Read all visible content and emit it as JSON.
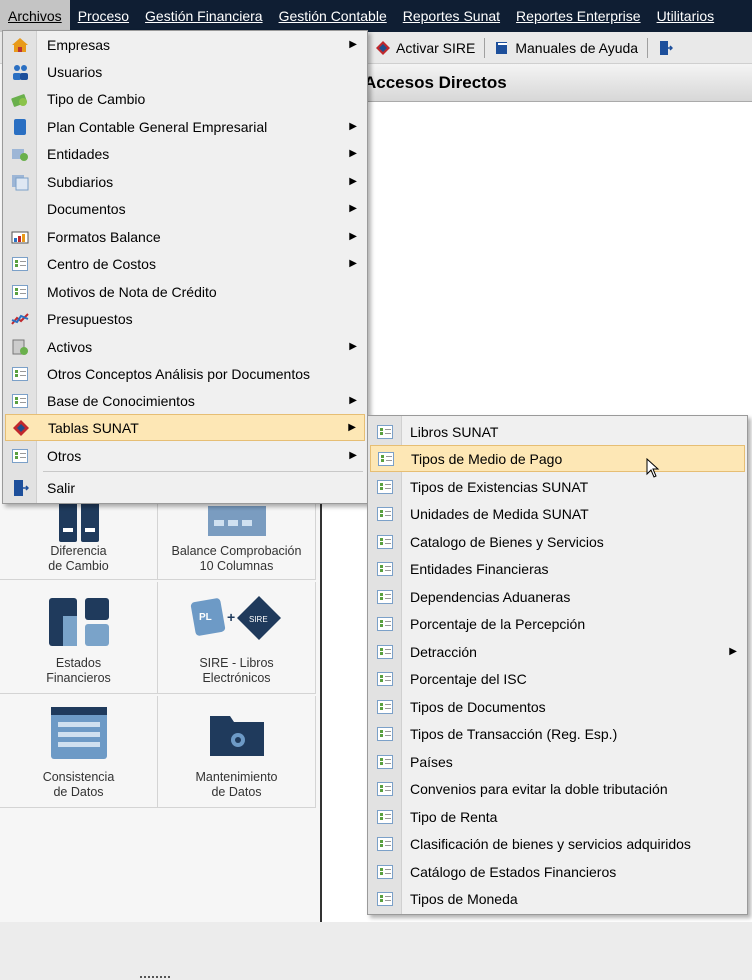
{
  "menubar": [
    {
      "label": "Archivos",
      "active": true
    },
    {
      "label": "Proceso"
    },
    {
      "label": "Gestión Financiera"
    },
    {
      "label": "Gestión Contable"
    },
    {
      "label": "Reportes Sunat"
    },
    {
      "label": "Reportes Enterprise"
    },
    {
      "label": "Utilitarios"
    }
  ],
  "toolbar": {
    "activar_sire": "Activar SIRE",
    "manuales": "Manuales de Ayuda"
  },
  "accesos": {
    "title": "Accesos Directos",
    "tiles": [
      {
        "line1": "Diferencia",
        "line2": "de Cambio",
        "icon": "calculator-icon"
      },
      {
        "line1": "Balance Comprobación",
        "line2": "10 Columnas",
        "icon": "grid-icon"
      },
      {
        "line1": "Estados",
        "line2": "Financieros",
        "icon": "columns-icon"
      },
      {
        "line1": "SIRE - Libros",
        "line2": "Electrónicos",
        "icon": "ple-sire-icon"
      },
      {
        "line1": "Consistencia",
        "line2": "de Datos",
        "icon": "window-icon"
      },
      {
        "line1": "Mantenimiento",
        "line2": "de Datos",
        "icon": "folder-gear-icon"
      }
    ]
  },
  "archivos_menu": [
    {
      "label": "Empresas",
      "sub": true,
      "icon": "home-icon"
    },
    {
      "label": "Usuarios",
      "sub": false,
      "icon": "users-icon"
    },
    {
      "label": "Tipo de Cambio",
      "sub": false,
      "icon": "money-icon"
    },
    {
      "label": "Plan Contable General Empresarial",
      "sub": true,
      "icon": "book-icon"
    },
    {
      "label": "Entidades",
      "sub": true,
      "icon": "entity-icon"
    },
    {
      "label": "Subdiarios",
      "sub": true,
      "icon": "subdiario-icon"
    },
    {
      "label": "Documentos",
      "sub": true,
      "icon": ""
    },
    {
      "label": "Formatos Balance",
      "sub": true,
      "icon": "chart-icon"
    },
    {
      "label": "Centro de Costos",
      "sub": true,
      "icon": "list-icon"
    },
    {
      "label": "Motivos de Nota de Crédito",
      "sub": false,
      "icon": "list-icon"
    },
    {
      "label": "Presupuestos",
      "sub": false,
      "icon": "line-chart-icon"
    },
    {
      "label": "Activos",
      "sub": true,
      "icon": "asset-icon"
    },
    {
      "label": "Otros Conceptos Análisis por Documentos",
      "sub": false,
      "icon": "list-icon"
    },
    {
      "label": "Base de Conocimientos",
      "sub": true,
      "icon": "list-icon"
    },
    {
      "label": "Tablas SUNAT",
      "sub": true,
      "icon": "sunat-icon",
      "highlight": true
    },
    {
      "label": "Otros",
      "sub": true,
      "icon": "list-icon"
    },
    {
      "label": "Salir",
      "sub": false,
      "icon": "exit-icon"
    }
  ],
  "tablas_sunat_menu": [
    {
      "label": "Libros SUNAT"
    },
    {
      "label": "Tipos de Medio de Pago",
      "highlight": true
    },
    {
      "label": "Tipos de Existencias SUNAT"
    },
    {
      "label": "Unidades de Medida SUNAT"
    },
    {
      "label": "Catalogo de Bienes y Servicios"
    },
    {
      "label": "Entidades Financieras"
    },
    {
      "label": "Dependencias Aduaneras"
    },
    {
      "label": "Porcentaje de la Percepción"
    },
    {
      "label": "Detracción",
      "sub": true
    },
    {
      "label": "Porcentaje del ISC"
    },
    {
      "label": "Tipos de Documentos"
    },
    {
      "label": "Tipos de Transacción (Reg. Esp.)"
    },
    {
      "label": "Países"
    },
    {
      "label": "Convenios para evitar la doble tributación"
    },
    {
      "label": "Tipo de Renta"
    },
    {
      "label": "Clasificación de bienes y servicios adquiridos"
    },
    {
      "label": "Catálogo de Estados Financieros"
    },
    {
      "label": "Tipos de Moneda"
    }
  ]
}
